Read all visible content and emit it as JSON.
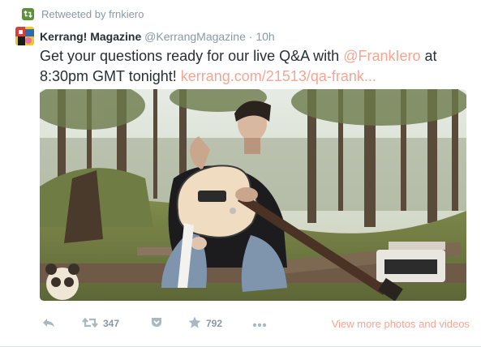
{
  "retweet": {
    "label": "Retweeted by frnkiero",
    "icon": "retweet-icon",
    "color": "#5c913b"
  },
  "author": {
    "name": "Kerrang! Magazine",
    "handle": "@KerrangMagazine",
    "separator": "·",
    "time": "10h"
  },
  "text": {
    "lead": "Get your questions ready for our live Q&A with ",
    "mention": "@FrankIero",
    "middle": " at 8:30pm GMT tonight! ",
    "url": "kerrang.com/21513/qa-frank..."
  },
  "media": {
    "icon": "photo-thumbnail"
  },
  "actions": {
    "reply_icon": "reply-icon",
    "retweet_icon": "retweet-icon",
    "retweet_count": "347",
    "pocket_icon": "pocket-icon",
    "favorite_icon": "star-icon",
    "favorite_count": "792",
    "more_icon": "more-dots-icon",
    "view_more": "View more photos and videos"
  },
  "colors": {
    "link": "#f7a593",
    "meta": "#8899a6",
    "text": "#292f33"
  }
}
